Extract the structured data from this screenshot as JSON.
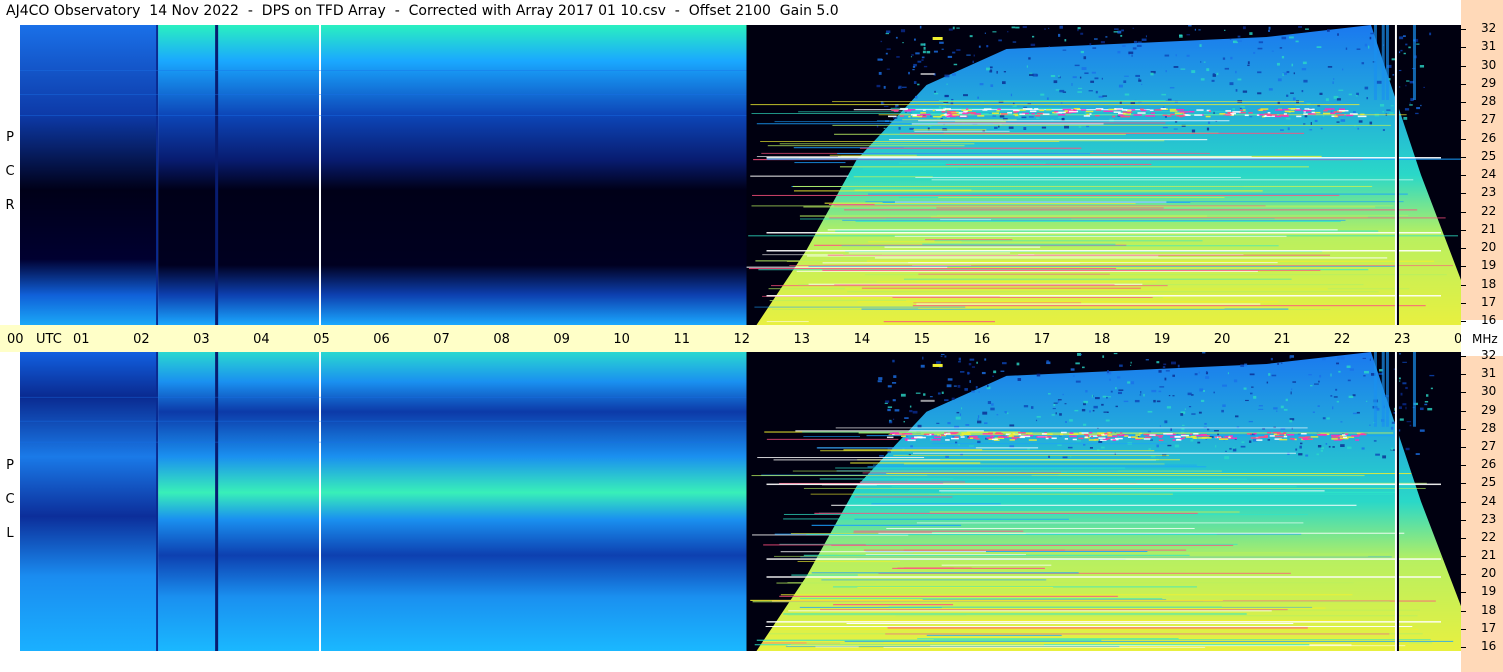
{
  "title": "AJ4CO Observatory  14 Nov 2022  -  DPS on TFD Array  -  Corrected with Array 2017 01 10.csv  -  Offset 2100  Gain 5.0",
  "panels": [
    {
      "id": "rcp",
      "label": [
        "R",
        "C",
        "P"
      ]
    },
    {
      "id": "lcp",
      "label": [
        "L",
        "C",
        "P"
      ]
    }
  ],
  "chart_data": {
    "type": "heatmap",
    "title": "AJ4CO Observatory  14 Nov 2022  -  DPS on TFD Array  -  Corrected with Array 2017 01 10.csv  -  Offset 2100  Gain 5.0",
    "x_axis": {
      "unit": "UTC",
      "range_hours": [
        0,
        24
      ],
      "tick_labels": [
        "00",
        "UTC",
        "01",
        "02",
        "03",
        "04",
        "05",
        "06",
        "07",
        "08",
        "09",
        "10",
        "11",
        "12",
        "13",
        "14",
        "15",
        "16",
        "17",
        "18",
        "19",
        "20",
        "21",
        "22",
        "23",
        "00"
      ]
    },
    "y_axis": {
      "unit": "MHz",
      "range_mhz": [
        16,
        32
      ],
      "tick_labels": [
        "32",
        "31",
        "30",
        "29",
        "28",
        "27",
        "26",
        "25",
        "24",
        "23",
        "22",
        "21",
        "20",
        "19",
        "18",
        "17",
        "16"
      ]
    },
    "series": [
      {
        "name": "RCP"
      },
      {
        "name": "LCP"
      }
    ],
    "colormap": [
      "#000010",
      "#0a1a8c",
      "#0b50d8",
      "#1aa0ff",
      "#2ee6c8",
      "#b8f060",
      "#f0f030",
      "#ff5080",
      "#ff2ec0",
      "#ffffff"
    ],
    "features": {
      "sunrise_transition_utc": 12.1,
      "solar_noise_band_mhz": 27.3,
      "white_vertical_lines_utc": [
        4.98,
        22.9
      ]
    }
  },
  "axis_labels": {
    "utc": "UTC",
    "mhz": "MHz",
    "time_ticks": [
      "00",
      "01",
      "02",
      "03",
      "04",
      "05",
      "06",
      "07",
      "08",
      "09",
      "10",
      "11",
      "12",
      "13",
      "14",
      "15",
      "16",
      "17",
      "18",
      "19",
      "20",
      "21",
      "22",
      "23",
      "00"
    ],
    "freq_ticks": [
      "32",
      "31",
      "30",
      "29",
      "28",
      "27",
      "26",
      "25",
      "24",
      "23",
      "22",
      "21",
      "20",
      "19",
      "18",
      "17",
      "16"
    ]
  }
}
